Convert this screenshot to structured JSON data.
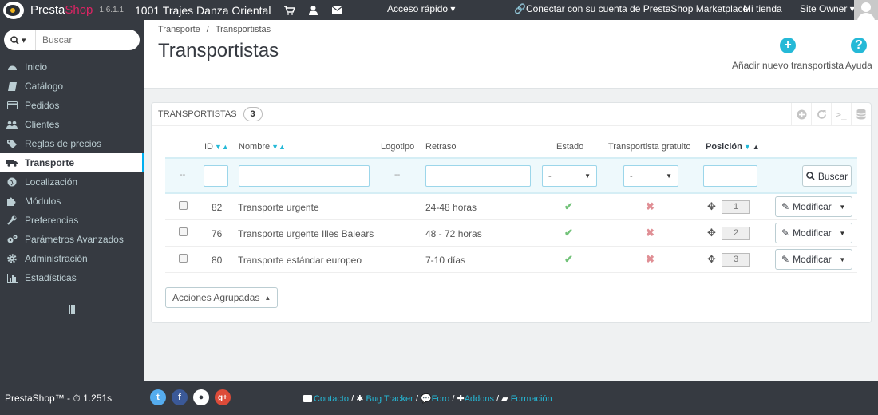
{
  "topbar": {
    "brand_presta": "Presta",
    "brand_shop": "Shop",
    "version": "1.6.1.1",
    "shop_name": "1001 Trajes Danza Oriental",
    "quick_access": "Acceso rápido",
    "connect": "Conectar con su cuenta de PrestaShop Marketplace",
    "my_store": "Mi tienda",
    "site_owner": "Site Owner"
  },
  "sidebar": {
    "search_placeholder": "Buscar",
    "items": [
      {
        "label": "Inicio",
        "icon": "dashboard-icon"
      },
      {
        "label": "Catálogo",
        "icon": "book-icon"
      },
      {
        "label": "Pedidos",
        "icon": "credit-card-icon"
      },
      {
        "label": "Clientes",
        "icon": "users-icon"
      },
      {
        "label": "Reglas de precios",
        "icon": "tags-icon"
      },
      {
        "label": "Transporte",
        "icon": "truck-icon",
        "active": true
      },
      {
        "label": "Localización",
        "icon": "globe-icon"
      },
      {
        "label": "Módulos",
        "icon": "puzzle-icon"
      },
      {
        "label": "Preferencias",
        "icon": "wrench-icon"
      },
      {
        "label": "Parámetros Avanzados",
        "icon": "cogs-icon"
      },
      {
        "label": "Administración",
        "icon": "gear-icon"
      },
      {
        "label": "Estadísticas",
        "icon": "bar-chart-icon"
      }
    ]
  },
  "header": {
    "breadcrumb": [
      "Transporte",
      "Transportistas"
    ],
    "title": "Transportistas",
    "add_carrier": "Añadir nuevo transportista",
    "help": "Ayuda"
  },
  "panel": {
    "title": "Transportistas",
    "count": "3",
    "columns": {
      "id": "ID",
      "name": "Nombre",
      "logo": "Logotipo",
      "delay": "Retraso",
      "status": "Estado",
      "free": "Transportista gratuito",
      "position": "Posición"
    },
    "filter": {
      "dash": "--",
      "select_default": "-",
      "search_btn": "Buscar"
    },
    "rows": [
      {
        "id": "82",
        "name": "Transporte urgente",
        "delay": "24-48 horas",
        "position": "1"
      },
      {
        "id": "76",
        "name": "Transporte urgente Illes Balears",
        "delay": "48 - 72 horas",
        "position": "2"
      },
      {
        "id": "80",
        "name": "Transporte estándar europeo",
        "delay": "7-10 días",
        "position": "3"
      }
    ],
    "edit_label": "Modificar",
    "bulk_actions": "Acciones Agrupadas"
  },
  "footer": {
    "left": "PrestaShop™ - ",
    "time": "1.251s",
    "links": [
      "Contacto",
      "Bug Tracker",
      "Foro",
      "Addons",
      "Formación"
    ]
  },
  "colors": {
    "dark": "#363a41",
    "accent": "#25b9d7",
    "enabled": "#72c279",
    "disabled": "#e08f95"
  }
}
